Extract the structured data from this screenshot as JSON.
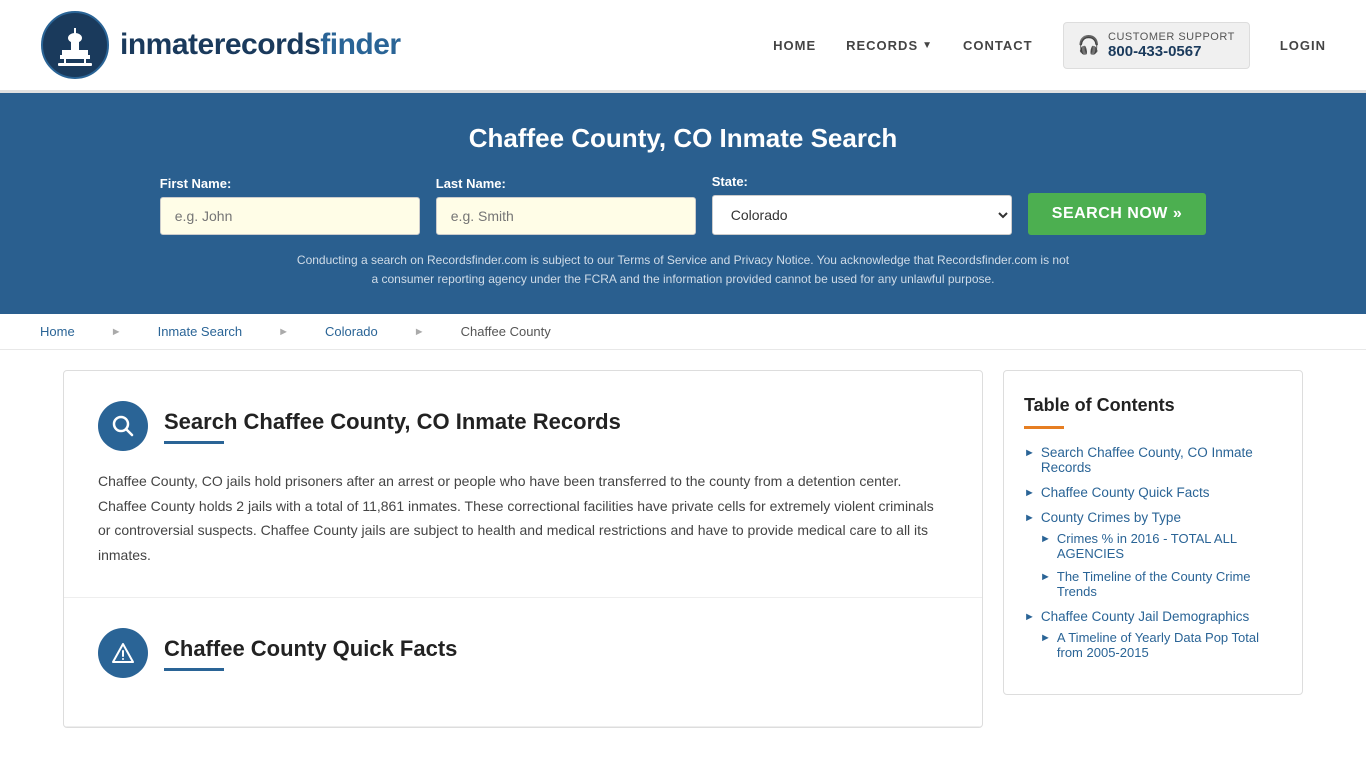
{
  "header": {
    "logo_text_normal": "inmaterecords",
    "logo_text_bold": "finder",
    "nav": {
      "home": "HOME",
      "records": "RECORDS",
      "contact": "CONTACT",
      "login": "LOGIN"
    },
    "customer_support_label": "CUSTOMER SUPPORT",
    "customer_support_number": "800-433-0567"
  },
  "search_banner": {
    "title": "Chaffee County, CO Inmate Search",
    "first_name_label": "First Name:",
    "first_name_placeholder": "e.g. John",
    "last_name_label": "Last Name:",
    "last_name_placeholder": "e.g. Smith",
    "state_label": "State:",
    "state_value": "Colorado",
    "search_button": "SEARCH NOW »",
    "disclaimer": "Conducting a search on Recordsfinder.com is subject to our Terms of Service and Privacy Notice. You acknowledge that Recordsfinder.com is not a consumer reporting agency under the FCRA and the information provided cannot be used for any unlawful purpose."
  },
  "breadcrumb": {
    "home": "Home",
    "inmate_search": "Inmate Search",
    "state": "Colorado",
    "county": "Chaffee County"
  },
  "main_section": {
    "section1": {
      "icon": "🔍",
      "title": "Search Chaffee County, CO Inmate Records",
      "body": "Chaffee County, CO jails hold prisoners after an arrest or people who have been transferred to the county from a detention center. Chaffee County holds 2 jails with a total of 11,861 inmates. These correctional facilities have private cells for extremely violent criminals or controversial suspects. Chaffee County jails are subject to health and medical restrictions and have to provide medical care to all its inmates."
    },
    "section2": {
      "icon": "⚠",
      "title": "Chaffee County Quick Facts"
    }
  },
  "toc": {
    "title": "Table of Contents",
    "items": [
      {
        "label": "Search Chaffee County, CO Inmate Records",
        "href": "#"
      },
      {
        "label": "Chaffee County Quick Facts",
        "href": "#"
      },
      {
        "label": "County Crimes by Type",
        "href": "#",
        "sub": [
          {
            "label": "Crimes % in 2016 - TOTAL ALL AGENCIES",
            "href": "#"
          },
          {
            "label": "The Timeline of the County Crime Trends",
            "href": "#"
          }
        ]
      },
      {
        "label": "Chaffee County Jail Demographics",
        "href": "#",
        "sub": [
          {
            "label": "A Timeline of Yearly Data Pop Total from 2005-2015",
            "href": "#"
          }
        ]
      }
    ]
  }
}
